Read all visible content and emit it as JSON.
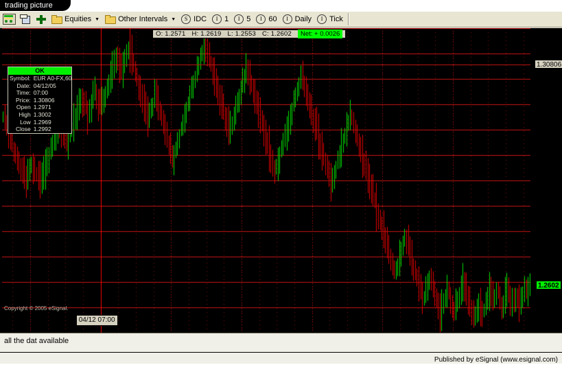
{
  "window": {
    "tab_title": "trading picture"
  },
  "toolbar": {
    "icons": [
      {
        "name": "chart-app-icon",
        "label": ""
      },
      {
        "name": "new-window-icon",
        "label": ""
      },
      {
        "name": "add-icon",
        "label": ""
      }
    ],
    "menus": [
      {
        "name": "equities-menu",
        "label": "Equities",
        "caret": "▼"
      },
      {
        "name": "other-intervals-menu",
        "label": "Other Intervals",
        "caret": "▼"
      }
    ],
    "intervals": [
      {
        "name": "interval-idc",
        "glyph": "S",
        "label": "IDC"
      },
      {
        "name": "interval-1",
        "glyph": "I",
        "label": "1"
      },
      {
        "name": "interval-5",
        "glyph": "I",
        "label": "5"
      },
      {
        "name": "interval-60",
        "glyph": "I",
        "label": "60"
      },
      {
        "name": "interval-daily",
        "glyph": "I",
        "label": "Daily"
      },
      {
        "name": "interval-tick",
        "glyph": "I",
        "label": "Tick"
      }
    ]
  },
  "quote_bar": {
    "open_label": "O: 1.2571",
    "high_label": "H: 1.2619",
    "low_label": "L: 1.2553",
    "close_label": "C: 1.2602",
    "net_label": "Net: + 0.0026",
    "net_color": "#00ff00"
  },
  "data_window": {
    "status": "OK",
    "rows": [
      {
        "key": "Symbol:",
        "value": "EUR A0-FX,60"
      },
      {
        "key": "Date:",
        "value": "04/12/05"
      },
      {
        "key": "Time:",
        "value": "07:00"
      },
      {
        "key": "Price:",
        "value": "1.30806"
      },
      {
        "key": "Open",
        "value": "1.2971"
      },
      {
        "key": "High",
        "value": "1.3002"
      },
      {
        "key": "Low",
        "value": "1.2969"
      },
      {
        "key": "Close",
        "value": "1.2992"
      }
    ]
  },
  "axis": {
    "scale_label": "1.30806",
    "last_price_label": "1.2602",
    "time_marker": "04/12 07:00"
  },
  "copyright": "Copyright © 2005 eSignal.",
  "status_bar": {
    "text": "all the dat available"
  },
  "footer": {
    "text": "Published by eSignal (www.esignal.com)"
  },
  "chart_data": {
    "type": "candlestick",
    "title": "EUR A0-FX,60",
    "xlabel": "",
    "ylabel": "",
    "ylim": [
      1.25,
      1.316
    ],
    "grid": true,
    "legend": "none",
    "background": "#000000",
    "grid_color": "#c81414",
    "grid_minor_color": "#8c0f0f",
    "up_color": "#00e000",
    "down_color": "#e00000",
    "crosshair_color": "#ff0000",
    "crosshair_x_index": 56,
    "annotations": [
      {
        "name": "scale-price-line",
        "value": 1.30806,
        "label": "1.30806"
      },
      {
        "name": "last-price-line",
        "value": 1.2602,
        "label": "1.2602"
      }
    ],
    "horizontal_gridline_values": [
      1.316,
      1.3105,
      1.305,
      1.2995,
      1.294,
      1.2885,
      1.283,
      1.2775,
      1.272,
      1.2665,
      1.261,
      1.2555
    ],
    "vertical_gridline_indices": [
      16,
      56,
      96,
      136,
      176,
      216,
      256
    ],
    "bar_count": 300,
    "closes": [
      1.2968,
      1.2955,
      1.294,
      1.2928,
      1.2915,
      1.2905,
      1.2893,
      1.288,
      1.2872,
      1.2863,
      1.2851,
      1.2846,
      1.284,
      1.2833,
      1.2846,
      1.2858,
      1.287,
      1.2861,
      1.2852,
      1.2844,
      1.2836,
      1.2829,
      1.2841,
      1.2855,
      1.2867,
      1.2878,
      1.289,
      1.2902,
      1.2915,
      1.2927,
      1.294,
      1.2952,
      1.2944,
      1.2936,
      1.2928,
      1.2918,
      1.2908,
      1.292,
      1.2934,
      1.2947,
      1.296,
      1.2974,
      1.2988,
      1.3001,
      1.3014,
      1.3005,
      1.2996,
      1.2985,
      1.2974,
      1.2988,
      1.3002,
      1.3016,
      1.3029,
      1.3015,
      1.3001,
      1.299,
      1.2992,
      1.3008,
      1.3022,
      1.3036,
      1.305,
      1.3064,
      1.3078,
      1.3092,
      1.3105,
      1.309,
      1.3076,
      1.3061,
      1.3075,
      1.3089,
      1.3103,
      1.3116,
      1.3102,
      1.3088,
      1.3074,
      1.306,
      1.3046,
      1.3032,
      1.3018,
      1.3004,
      1.299,
      1.2976,
      1.2962,
      1.2976,
      1.299,
      1.3004,
      1.3018,
      1.3004,
      1.299,
      1.2976,
      1.2962,
      1.2948,
      1.2934,
      1.292,
      1.2906,
      1.2892,
      1.2878,
      1.2892,
      1.2906,
      1.292,
      1.2934,
      1.2948,
      1.2962,
      1.2976,
      1.299,
      1.3004,
      1.3018,
      1.3032,
      1.3046,
      1.306,
      1.3074,
      1.3088,
      1.3102,
      1.3116,
      1.313,
      1.3116,
      1.3102,
      1.3088,
      1.3074,
      1.306,
      1.3046,
      1.3032,
      1.3018,
      1.3004,
      1.299,
      1.2976,
      1.2962,
      1.2948,
      1.2934,
      1.2948,
      1.2962,
      1.2976,
      1.299,
      1.3004,
      1.3018,
      1.3032,
      1.3046,
      1.306,
      1.3074,
      1.306,
      1.3046,
      1.3032,
      1.3018,
      1.3004,
      1.299,
      1.2976,
      1.2962,
      1.2948,
      1.2934,
      1.292,
      1.2906,
      1.2892,
      1.2878,
      1.2864,
      1.285,
      1.2864,
      1.2878,
      1.2892,
      1.2906,
      1.292,
      1.2934,
      1.2948,
      1.2962,
      1.2976,
      1.299,
      1.3004,
      1.3018,
      1.3032,
      1.3046,
      1.306,
      1.3046,
      1.3032,
      1.3018,
      1.3004,
      1.299,
      1.2976,
      1.2962,
      1.2948,
      1.2934,
      1.292,
      1.2906,
      1.2892,
      1.2878,
      1.2864,
      1.285,
      1.2836,
      1.2822,
      1.2836,
      1.285,
      1.2864,
      1.2878,
      1.2892,
      1.2906,
      1.292,
      1.2934,
      1.2948,
      1.2962,
      1.2976,
      1.2962,
      1.2948,
      1.2934,
      1.292,
      1.2906,
      1.2892,
      1.2878,
      1.2864,
      1.285,
      1.2836,
      1.2822,
      1.2808,
      1.2794,
      1.278,
      1.2766,
      1.2752,
      1.2738,
      1.2724,
      1.271,
      1.2696,
      1.2682,
      1.2668,
      1.2654,
      1.264,
      1.2626,
      1.264,
      1.2654,
      1.2668,
      1.2682,
      1.2696,
      1.271,
      1.2696,
      1.2682,
      1.2668,
      1.2654,
      1.264,
      1.2626,
      1.2612,
      1.2598,
      1.2584,
      1.257,
      1.2584,
      1.2598,
      1.2612,
      1.2626,
      1.2612,
      1.2598,
      1.2584,
      1.257,
      1.2556,
      1.2542,
      1.2556,
      1.257,
      1.2584,
      1.2598,
      1.2584,
      1.257,
      1.2556,
      1.2542,
      1.2556,
      1.257,
      1.2584,
      1.2598,
      1.2612,
      1.2598,
      1.2584,
      1.257,
      1.2556,
      1.2542,
      1.2528,
      1.2542,
      1.2556,
      1.257,
      1.2556,
      1.2542,
      1.2556,
      1.257,
      1.2584,
      1.2598,
      1.2584,
      1.257,
      1.2584,
      1.2598,
      1.2584,
      1.257,
      1.2556,
      1.257,
      1.2584,
      1.2598,
      1.2584,
      1.257,
      1.2584,
      1.257,
      1.2584,
      1.257,
      1.2556,
      1.257,
      1.2584,
      1.2598,
      1.2586,
      1.2594,
      1.2602
    ]
  }
}
